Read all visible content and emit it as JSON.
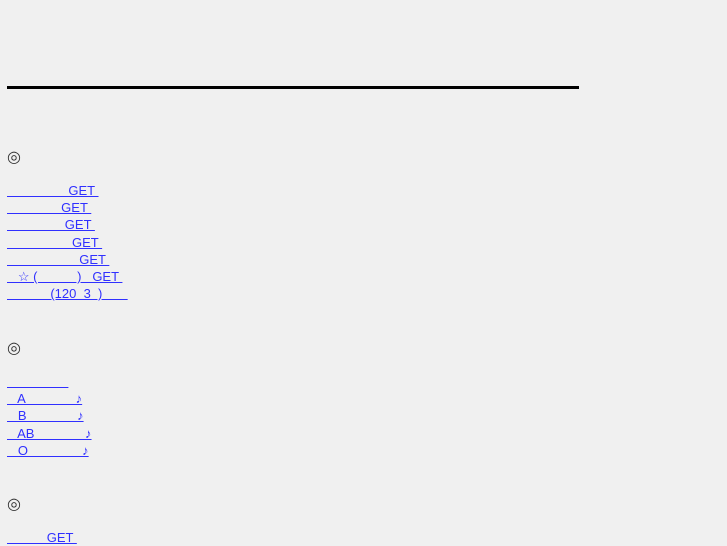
{
  "sections": [
    {
      "mark": "◎",
      "links": [
        "                 GET ",
        "               GET ",
        "                GET ",
        "                  GET ",
        "                    GET ",
        "   ☆ (           )   GET ",
        "            (120  3  )       "
      ]
    },
    {
      "mark": "◎",
      "links": [
        "                 ",
        "   A              ♪",
        "   B              ♪",
        "   AB              ♪",
        "   O               ♪"
      ]
    },
    {
      "mark": "◎",
      "links": [
        "           GET "
      ]
    }
  ],
  "colors": {
    "link": "#3030ff",
    "rule": "#000000",
    "background": "#f0f0f0"
  }
}
